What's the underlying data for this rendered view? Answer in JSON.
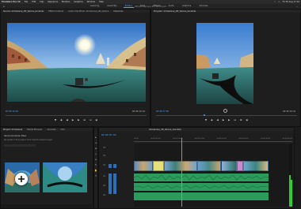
{
  "menubar": {
    "items": [
      "Premiere Pro CC",
      "File",
      "Edit",
      "Clip",
      "Sequence",
      "Markers",
      "Graphics",
      "Window",
      "Help"
    ],
    "clock": "Fri 30 Aug 17:10"
  },
  "workspace": {
    "tabs": [
      "Learning",
      "Assembly",
      "Editing",
      "Color",
      "Effects",
      "Audio",
      "Graphics",
      "Libraries"
    ],
    "active_index": 2,
    "project_title": "RECAP Premiere Pro VR Project"
  },
  "source_monitor": {
    "tabs": [
      "Source: Immersive_VR_Venice_Gondola",
      "Effect Controls",
      "Audio Clip Mixer: Immersive_VR_Venice",
      "Metadata"
    ],
    "timecode_left": "00:00:10:04",
    "timecode_right": "00:00:19:18"
  },
  "program_monitor": {
    "tab": "Program: Immersive_VR_Venice_Gondola",
    "timecode_left": "00:00:07:06",
    "timecode_right": "00:00:30:10"
  },
  "project_panel": {
    "tabs": [
      "Project: Immersive",
      "Media Browser",
      "Libraries",
      "Info"
    ],
    "line1": "Venice Gondola Video",
    "line2": "No assets in this project. Click Import media to begin.",
    "thumbnail_count": 2
  },
  "timeline": {
    "tab": "Immersive_VR_Venice_Gondola",
    "timecode": "00:00:07:06",
    "track_labels": [
      "V3",
      "V2",
      "V1",
      "A1",
      "A2",
      "A3"
    ],
    "ruler_ticks": [
      "00:00",
      "00:00:05:00",
      "00:00:10:00",
      "00:00:15:00",
      "00:00:20:00",
      "00:00:25:00",
      "00:00:30:00",
      "00:00:35:00"
    ]
  },
  "colors": {
    "accent": "#4da3ff",
    "audio": "#2c9c5c",
    "video_clip": "#6f62c4",
    "highlight_clip": "#e5e07a",
    "pink_clip": "#c98cd0"
  }
}
